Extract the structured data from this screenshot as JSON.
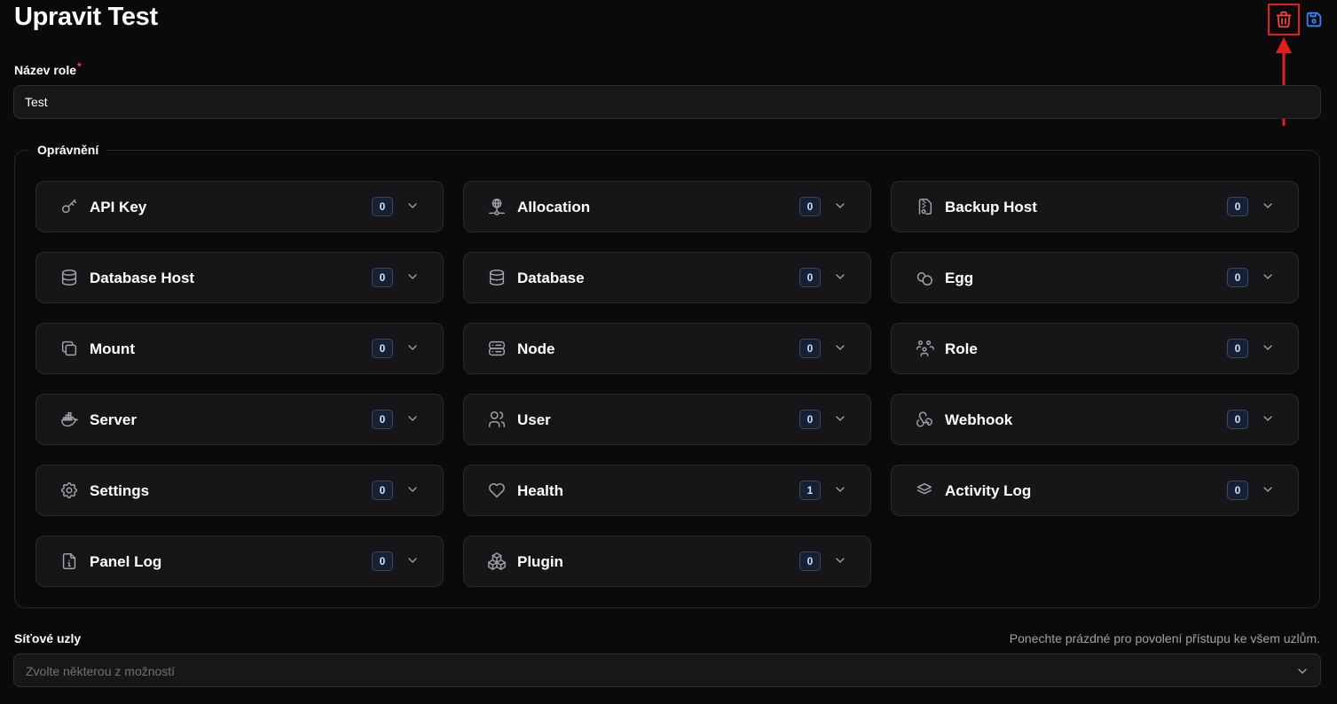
{
  "header": {
    "title": "Upravit Test"
  },
  "role_name": {
    "label": "Název role",
    "required_mark": "*",
    "value": "Test"
  },
  "permissions": {
    "legend": "Oprávnění",
    "items": [
      {
        "label": "API Key",
        "count": "0",
        "icon": "key-icon"
      },
      {
        "label": "Allocation",
        "count": "0",
        "icon": "network-icon"
      },
      {
        "label": "Backup Host",
        "count": "0",
        "icon": "file-zip-icon"
      },
      {
        "label": "Database Host",
        "count": "0",
        "icon": "database-icon"
      },
      {
        "label": "Database",
        "count": "0",
        "icon": "database-icon"
      },
      {
        "label": "Egg",
        "count": "0",
        "icon": "eggs-icon"
      },
      {
        "label": "Mount",
        "count": "0",
        "icon": "copy-icon"
      },
      {
        "label": "Node",
        "count": "0",
        "icon": "server-icon"
      },
      {
        "label": "Role",
        "count": "0",
        "icon": "users-group-icon"
      },
      {
        "label": "Server",
        "count": "0",
        "icon": "docker-icon"
      },
      {
        "label": "User",
        "count": "0",
        "icon": "users-icon"
      },
      {
        "label": "Webhook",
        "count": "0",
        "icon": "webhook-icon"
      },
      {
        "label": "Settings",
        "count": "0",
        "icon": "settings-icon"
      },
      {
        "label": "Health",
        "count": "1",
        "icon": "heart-icon"
      },
      {
        "label": "Activity Log",
        "count": "0",
        "icon": "stack-icon"
      },
      {
        "label": "Panel Log",
        "count": "0",
        "icon": "file-info-icon"
      },
      {
        "label": "Plugin",
        "count": "0",
        "icon": "packages-icon"
      }
    ]
  },
  "nodes": {
    "label": "Síťové uzly",
    "hint": "Ponechte prázdné pro povolení přístupu ke všem uzlům.",
    "placeholder": "Zvolte některou z možností"
  },
  "colors": {
    "background": "#0a0a0b",
    "delete_highlight": "#e0201f",
    "save_icon": "#3b82f6",
    "badge_border": "#3a4a66"
  }
}
